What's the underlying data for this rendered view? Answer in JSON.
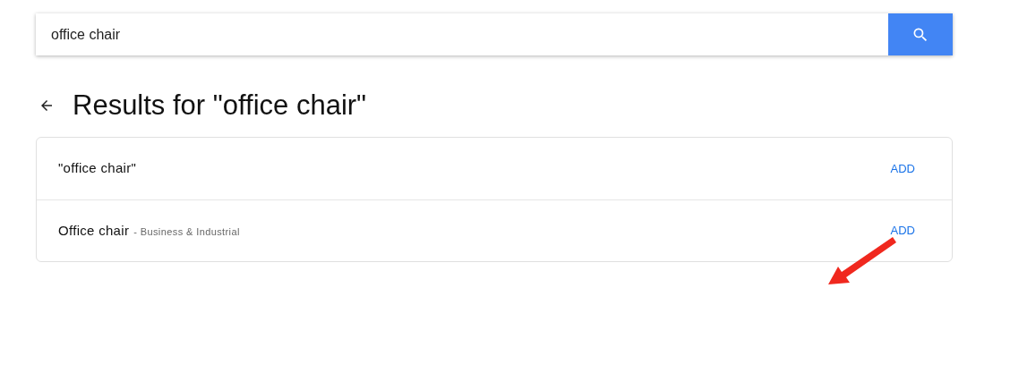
{
  "search": {
    "value": "office chair"
  },
  "heading": "Results for \"office chair\"",
  "results": [
    {
      "title": "\"office chair\"",
      "action": "ADD"
    },
    {
      "title": "Office chair",
      "category": "- Business & Industrial",
      "action": "ADD"
    }
  ]
}
